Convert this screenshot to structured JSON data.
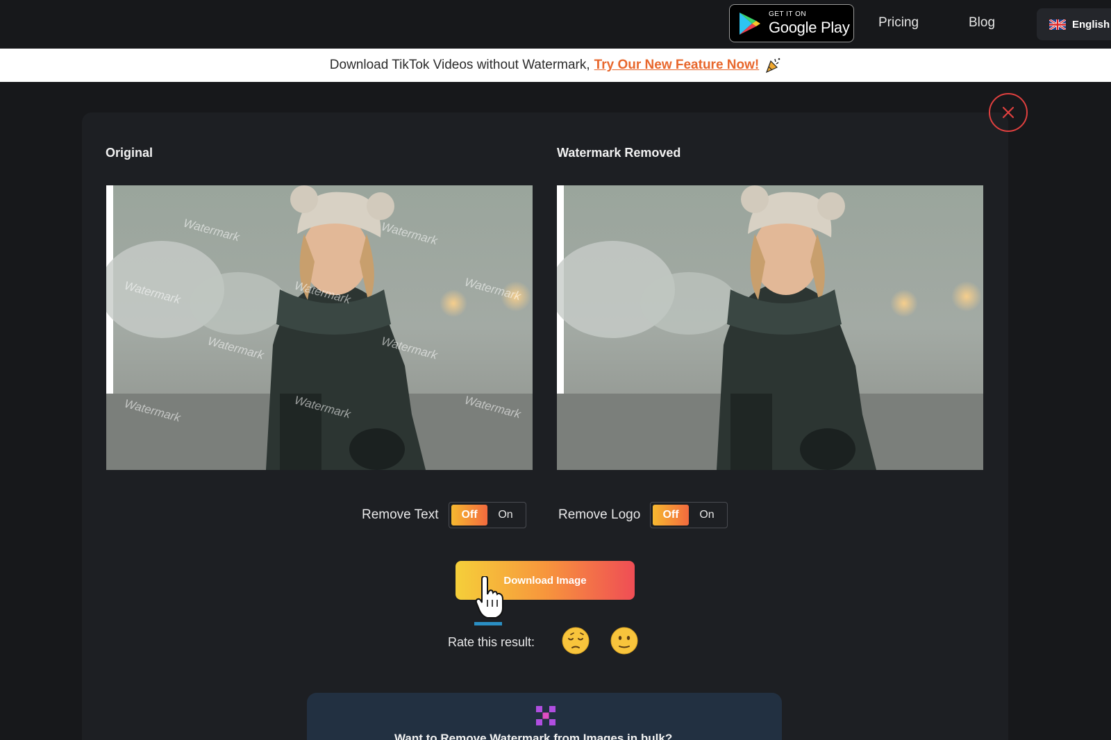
{
  "topnav": {
    "google_play_small": "GET IT ON",
    "google_play_big": "Google Play",
    "pricing": "Pricing",
    "blog": "Blog",
    "language": "English"
  },
  "banner": {
    "text": "Download TikTok Videos without Watermark,",
    "link": "Try Our New Feature Now!"
  },
  "comparison": {
    "original_title": "Original",
    "removed_title": "Watermark Removed",
    "watermark_text": "Watermark"
  },
  "controls": {
    "remove_text_label": "Remove Text",
    "remove_logo_label": "Remove Logo",
    "off_label": "Off",
    "on_label": "On",
    "remove_text_state": "Off",
    "remove_logo_state": "Off",
    "download_label": "Download Image",
    "rate_label": "Rate this result:"
  },
  "bulk": {
    "text": "Want to Remove Watermark from Images in bulk?"
  },
  "colors": {
    "accent_orange": "#f26a3e",
    "accent_yellow": "#f6b830",
    "close_red": "#e0403f",
    "link_orange": "#e8672c"
  },
  "icons": [
    "google-play-icon",
    "uk-flag-icon",
    "party-popper-icon",
    "close-icon",
    "pointer-hand-icon",
    "sad-face-icon",
    "neutral-face-icon",
    "bulk-grid-icon"
  ]
}
